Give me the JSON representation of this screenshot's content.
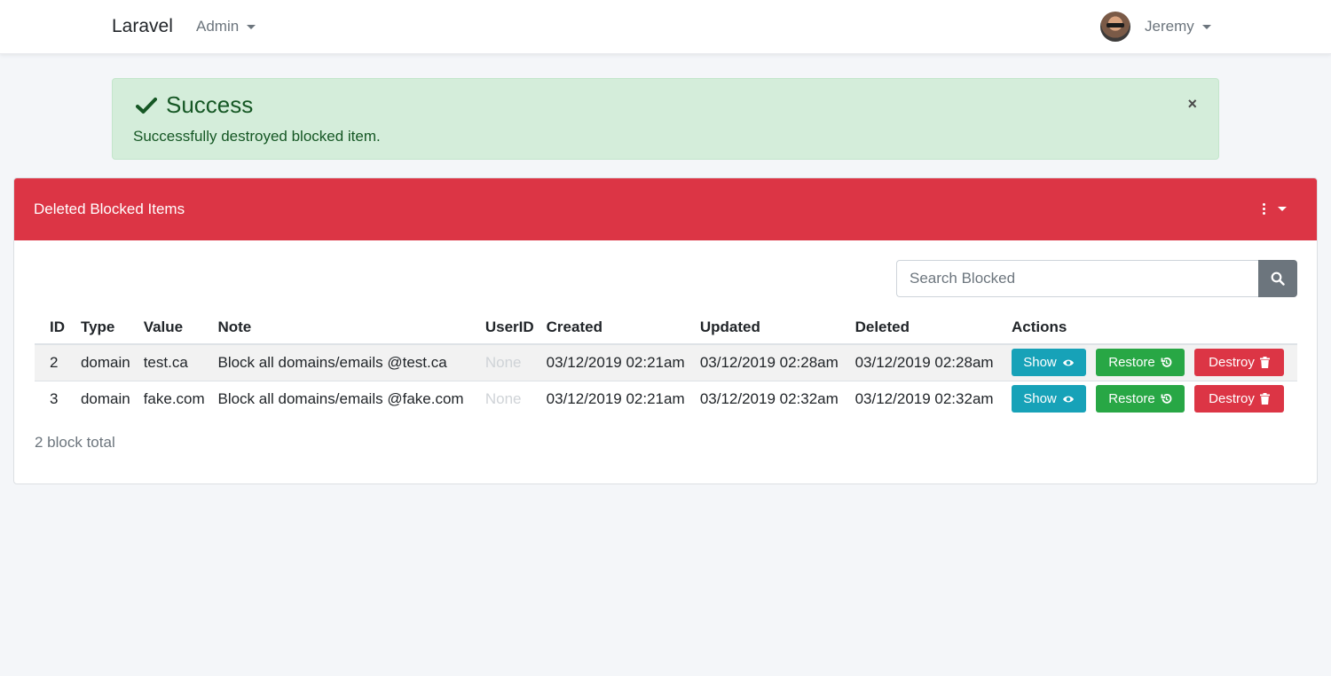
{
  "navbar": {
    "brand": "Laravel",
    "admin_menu": "Admin",
    "user_name": "Jeremy"
  },
  "alert": {
    "heading": "Success",
    "message": "Successfully destroyed blocked item.",
    "close": "×"
  },
  "card": {
    "title": "Deleted Blocked Items",
    "search_placeholder": "Search Blocked",
    "total": "2 block total"
  },
  "table": {
    "headers": [
      "ID",
      "Type",
      "Value",
      "Note",
      "UserID",
      "Created",
      "Updated",
      "Deleted",
      "Actions"
    ],
    "rows": [
      {
        "id": "2",
        "type": "domain",
        "value": "test.ca",
        "note": "Block all domains/emails @test.ca",
        "user_id": "None",
        "created": "03/12/2019 02:21am",
        "updated": "03/12/2019 02:28am",
        "deleted": "03/12/2019 02:28am"
      },
      {
        "id": "3",
        "type": "domain",
        "value": "fake.com",
        "note": "Block all domains/emails @fake.com",
        "user_id": "None",
        "created": "03/12/2019 02:21am",
        "updated": "03/12/2019 02:32am",
        "deleted": "03/12/2019 02:32am"
      }
    ]
  },
  "actions": {
    "show": "Show",
    "restore": "Restore",
    "destroy": "Destroy"
  },
  "colors": {
    "success_bg": "#d4edda",
    "danger": "#dc3545",
    "info": "#17a2b8",
    "success": "#28a745",
    "secondary": "#6c757d"
  }
}
